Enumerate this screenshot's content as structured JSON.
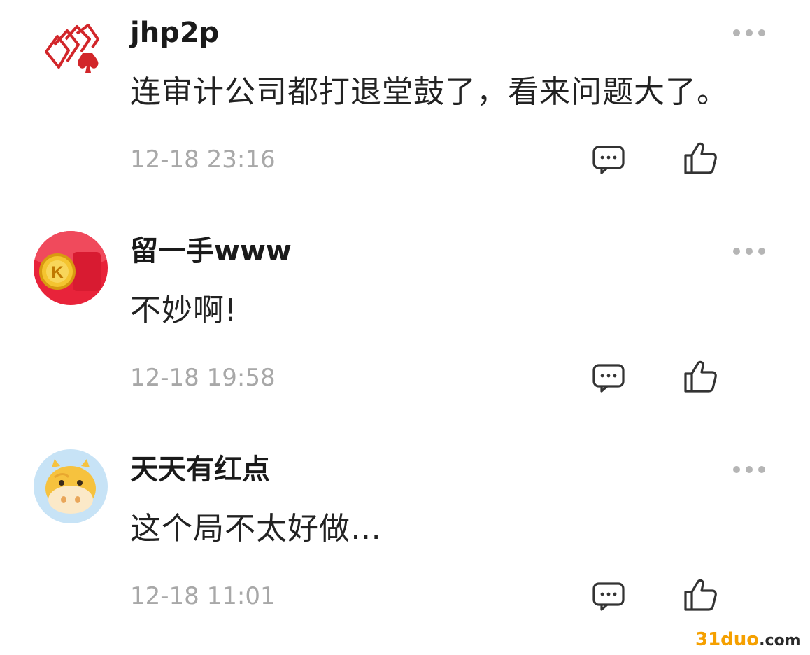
{
  "comments": [
    {
      "avatar_icon": "playing-cards-icon",
      "username": "jhp2p",
      "content": "连审计公司都打退堂鼓了，看来问题大了。",
      "timestamp": "12-18 23:16"
    },
    {
      "avatar_icon": "red-envelope-coin-icon",
      "username": "留一手www",
      "content": "不妙啊!",
      "timestamp": "12-18 19:58"
    },
    {
      "avatar_icon": "cow-face-icon",
      "username": "天天有红点",
      "content": "这个局不太好做…",
      "timestamp": "12-18 11:01"
    }
  ],
  "icons": {
    "more": "more-options-icon",
    "reply": "comment-bubble-icon",
    "like": "thumbs-up-icon"
  },
  "watermark": {
    "main": "31duo",
    "suffix": ".com"
  },
  "colors": {
    "username": "#1a1a1a",
    "content": "#222222",
    "timestamp": "#a8a8a8",
    "icon_stroke": "#333333",
    "more_dots": "#b5b5b5",
    "watermark": "#f5a000"
  }
}
